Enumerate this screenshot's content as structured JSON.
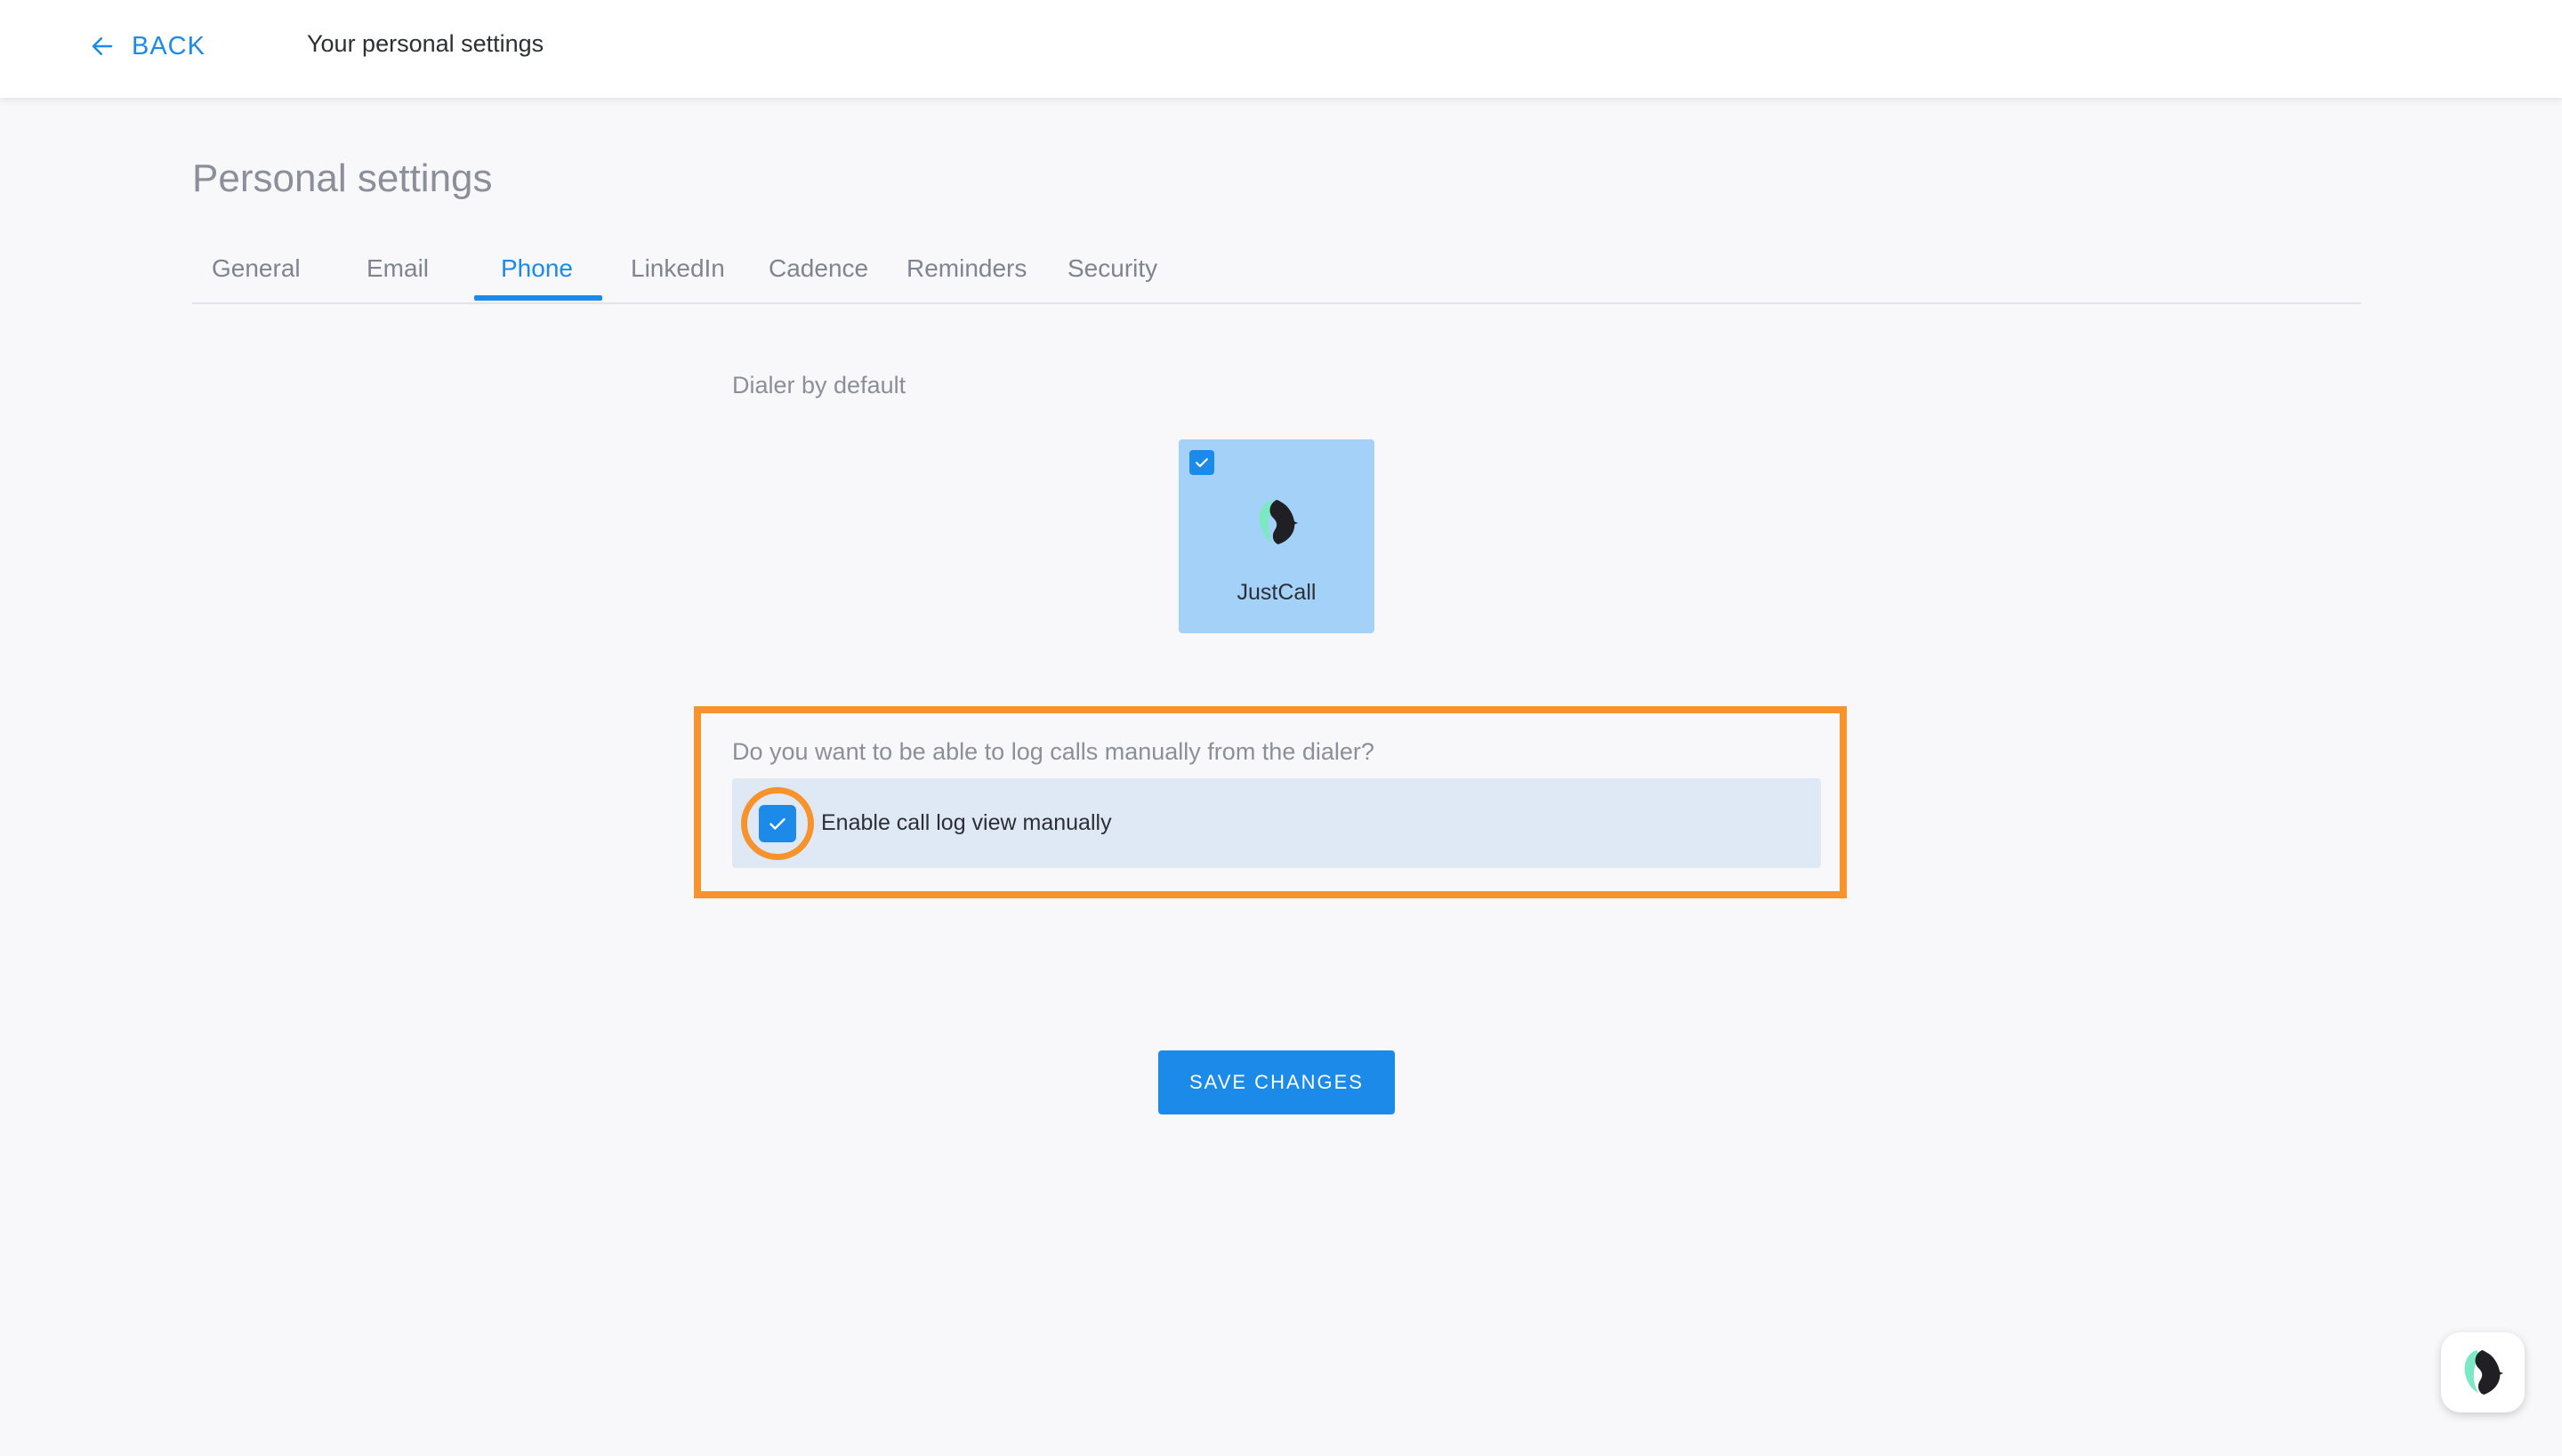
{
  "topbar": {
    "back_label": "BACK",
    "title": "Your personal settings"
  },
  "page": {
    "title": "Personal settings"
  },
  "tabs": [
    {
      "label": "General",
      "active": false
    },
    {
      "label": "Email",
      "active": false
    },
    {
      "label": "Phone",
      "active": true
    },
    {
      "label": "LinkedIn",
      "active": false
    },
    {
      "label": "Cadence",
      "active": false
    },
    {
      "label": "Reminders",
      "active": false
    },
    {
      "label": "Security",
      "active": false
    }
  ],
  "dialer": {
    "section_label": "Dialer by default",
    "option_name": "JustCall",
    "selected": true,
    "logo_icon": "justcall-logo-icon"
  },
  "call_log": {
    "question": "Do you want to be able to log calls manually from the dialer?",
    "checkbox_label": "Enable call log view manually",
    "checked": true
  },
  "actions": {
    "save_label": "SAVE CHANGES"
  },
  "colors": {
    "accent": "#1b8ae8",
    "highlight": "#f7932d",
    "card_bg": "#a3d1f7"
  }
}
